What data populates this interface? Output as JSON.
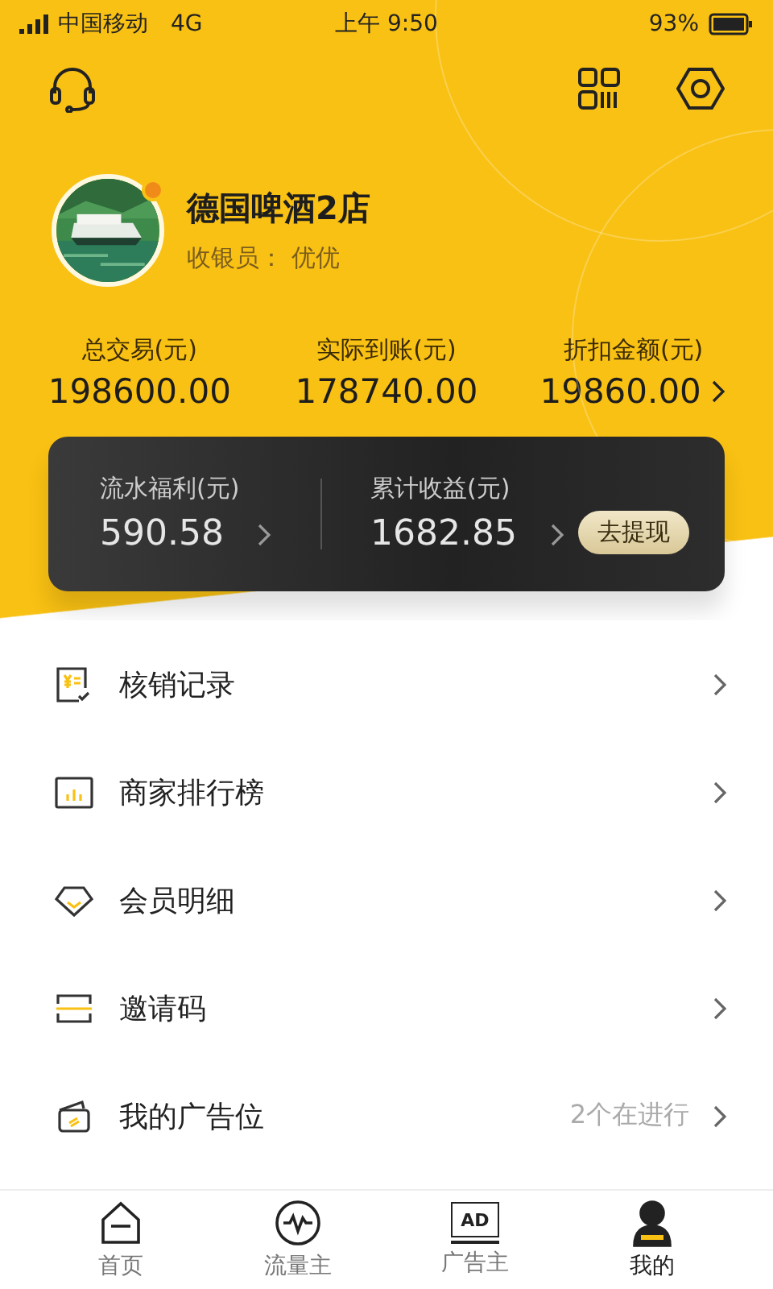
{
  "status_bar": {
    "carrier": "中国移动",
    "network": "4G",
    "time": "上午 9:50",
    "battery": "93%"
  },
  "profile": {
    "name": "德国啤酒2店",
    "cashier": "收银员： 优优",
    "online": true
  },
  "stats": [
    {
      "label": "总交易(元)",
      "value": "198600.00",
      "arrow": false
    },
    {
      "label": "实际到账(元)",
      "value": "178740.00",
      "arrow": false
    },
    {
      "label": "折扣金额(元)",
      "value": "19860.00",
      "arrow": true
    }
  ],
  "earnings": {
    "items": [
      {
        "label": "流水福利(元)",
        "value": "590.58"
      },
      {
        "label": "累计收益(元)",
        "value": "1682.85"
      }
    ],
    "button": "去提现"
  },
  "menu": [
    {
      "kind": "receipt",
      "label": "核销记录"
    },
    {
      "kind": "chart",
      "label": "商家排行榜"
    },
    {
      "kind": "diamond",
      "label": "会员明细"
    },
    {
      "kind": "ticket",
      "label": "邀请码"
    },
    {
      "kind": "cards",
      "label": "我的广告位",
      "note": "2个在进行"
    }
  ],
  "tabs": [
    {
      "kind": "home",
      "label": "首页",
      "selected": false
    },
    {
      "kind": "pulse",
      "label": "流量主",
      "selected": false
    },
    {
      "kind": "ad",
      "label": "广告主",
      "icon_text": "AD",
      "selected": false
    },
    {
      "kind": "person",
      "label": "我的",
      "selected": true
    }
  ]
}
